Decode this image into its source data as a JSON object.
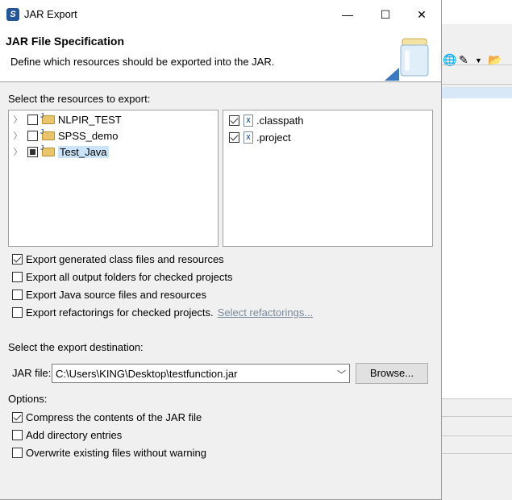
{
  "window": {
    "title": "JAR Export",
    "minimize_glyph": "—",
    "maximize_glyph": "☐",
    "close_glyph": "✕"
  },
  "banner": {
    "title": "JAR File Specification",
    "description": "Define which resources should be exported into the JAR."
  },
  "resources": {
    "label": "Select the resources to export:",
    "projects": [
      {
        "label": "NLPIR_TEST",
        "state": "unchecked"
      },
      {
        "label": "SPSS_demo",
        "state": "unchecked"
      },
      {
        "label": "Test_Java",
        "state": "partial",
        "selected": true
      }
    ],
    "files": [
      {
        "label": ".classpath",
        "checked": true
      },
      {
        "label": ".project",
        "checked": true
      }
    ]
  },
  "export_options": [
    {
      "label": "Export generated class files and resources",
      "checked": true
    },
    {
      "label": "Export all output folders for checked projects",
      "checked": false
    },
    {
      "label": "Export Java source files and resources",
      "checked": false
    },
    {
      "label": "Export refactorings for checked projects.",
      "checked": false
    }
  ],
  "select_refactorings_link": "Select refactorings...",
  "destination": {
    "label": "Select the export destination:",
    "jar_file_label": "JAR file:",
    "jar_file_value": "C:\\Users\\KING\\Desktop\\testfunction.jar",
    "browse_label": "Browse..."
  },
  "options": {
    "label": "Options:",
    "items": [
      {
        "label": "Compress the contents of the JAR file",
        "checked": true
      },
      {
        "label": "Add directory entries",
        "checked": false
      },
      {
        "label": "Overwrite existing files without warning",
        "checked": false
      }
    ]
  },
  "colors": {
    "selection": "#cce4f7",
    "dialog_bg": "#f0f0f0",
    "link": "#7a8a9a"
  }
}
